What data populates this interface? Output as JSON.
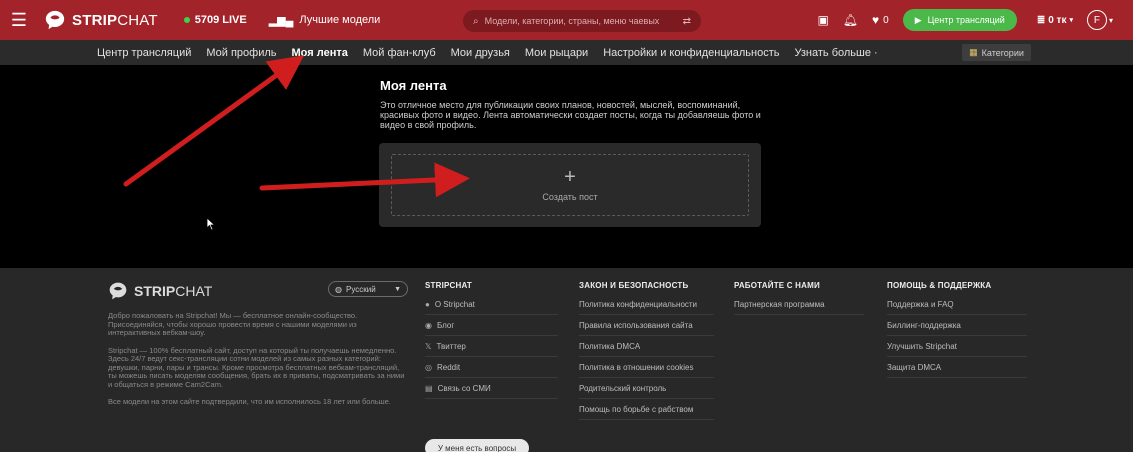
{
  "header": {
    "brand_bold": "STRIP",
    "brand_rest": "CHAT",
    "live_count": "5709 LIVE",
    "top_models": "Лучшие модели",
    "search_placeholder": "Модели, категории, страны, меню чаевых",
    "fav_count": "0",
    "broadcast_label": "Центр трансляций",
    "tokens": "0 тк",
    "avatar_letter": "F"
  },
  "subnav": {
    "items": [
      {
        "label": "Центр трансляций"
      },
      {
        "label": "Мой профиль"
      },
      {
        "label": "Моя лента",
        "active": true
      },
      {
        "label": "Мой фан-клуб"
      },
      {
        "label": "Мои друзья"
      },
      {
        "label": "Мои рыцари"
      },
      {
        "label": "Настройки и конфиденциальность"
      },
      {
        "label": "Узнать больше ·"
      }
    ],
    "categories_label": "Категории"
  },
  "feed": {
    "title": "Моя лента",
    "description": "Это отличное место для публикации своих планов, новостей, мыслей, воспоминаний, красивых фото и видео. Лента автоматически создает посты, когда ты добавляешь фото и видео в свой профиль.",
    "create_post": "Создать пост"
  },
  "footer": {
    "brand_bold": "STRIP",
    "brand_rest": "CHAT",
    "language": "Русский",
    "about": [
      "Добро пожаловать на Stripchat! Мы — бесплатное онлайн-сообщество. Присоединяйся, чтобы хорошо провести время с нашими моделями из интерактивных вебкам-шоу.",
      "Stripchat — 100% бесплатный сайт, доступ на который ты получаешь немедленно. Здесь 24/7 ведут секс-трансляции сотни моделей из самых разных категорий: девушки, парни, пары и трансы. Кроме просмотра бесплатных вебкам-трансляций, ты можешь писать моделям сообщения, брать их в приваты, подсматривать за ними и общаться в режиме Cam2Cam.",
      "Все модели на этом сайте подтвердили, что им исполнилось 18 лет или больше."
    ],
    "columns": [
      {
        "heading": "STRIPCHAT",
        "links": [
          "О Stripchat",
          "Блог",
          "Твиттер",
          "Reddit",
          "Связь со СМИ"
        ]
      },
      {
        "heading": "ЗАКОН И БЕЗОПАСНОСТЬ",
        "links": [
          "Политика конфиденциальности",
          "Правила использования сайта",
          "Политика DMCA",
          "Политика в отношении cookies",
          "Родительский контроль",
          "Помощь по борьбе с рабством"
        ]
      },
      {
        "heading": "РАБОТАЙТЕ С НАМИ",
        "links": [
          "Партнерская программа"
        ]
      },
      {
        "heading": "ПОМОЩЬ & ПОДДЕРЖКА",
        "links": [
          "Поддержка и FAQ",
          "Биллинг-поддержка",
          "Улучшить Stripchat",
          "Защита DMCA"
        ]
      }
    ],
    "question_button": "У меня есть вопросы"
  },
  "colors": {
    "header_bg": "#a3232a",
    "subnav_bg": "#2b2b2b",
    "accent_green": "#4bb84a",
    "annotation_arrow": "#d01e1e",
    "footer_bg": "#282828"
  }
}
